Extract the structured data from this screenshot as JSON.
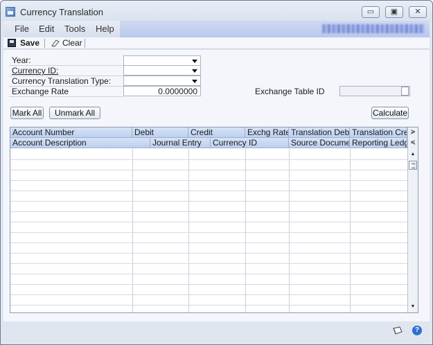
{
  "window": {
    "title": "Currency Translation",
    "controls": {
      "minimize": "▭",
      "restore": "▣",
      "close": "✕"
    }
  },
  "menu": {
    "items": [
      "File",
      "Edit",
      "Tools",
      "Help"
    ]
  },
  "toolbar": {
    "save_label": "Save",
    "clear_label": "Clear"
  },
  "form": {
    "year_label": "Year:",
    "currency_id_label": "Currency ID:",
    "translation_type_label": "Currency Translation Type:",
    "exchange_rate_label": "Exchange Rate",
    "exchange_rate_value": "0.0000000",
    "exchange_table_label": "Exchange Table ID"
  },
  "buttons": {
    "mark_all": "Mark All",
    "unmark_all": "Unmark All",
    "calculate": "Calculate"
  },
  "grid": {
    "header_row1": [
      "Account Number",
      "Debit",
      "Credit",
      "Exchg Rate",
      "Translation Debit",
      "Translation Credit"
    ],
    "header_row2": [
      "Account Description",
      "Journal Entry",
      "Currency ID",
      "Source Document",
      "Reporting Ledger"
    ],
    "scroll_icons": {
      "expand": "≽",
      "collapse": "≼",
      "up": "▲",
      "down": "▼"
    }
  },
  "colors": {
    "accent": "#2f6fd0",
    "header": "#bcd0ef",
    "menubar": "#b9c8ee"
  }
}
